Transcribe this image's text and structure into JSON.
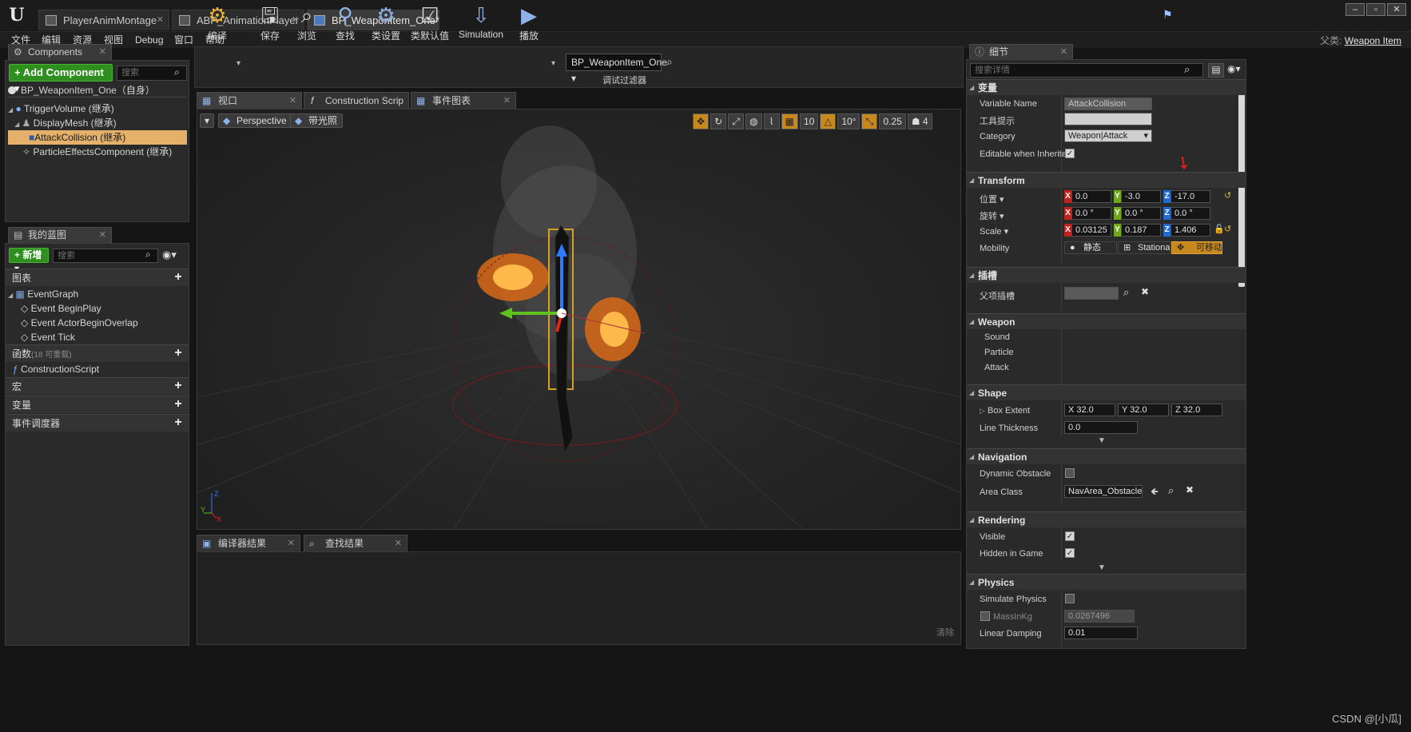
{
  "doc_tabs": [
    {
      "label": "PlayerAnimMontage",
      "active": false
    },
    {
      "label": "ABP_AnimationPlayer",
      "active": false
    },
    {
      "label": "BP_WeaponItem_One*",
      "active": true
    }
  ],
  "window_buttons": [
    "–",
    "▫",
    "✕"
  ],
  "menu": [
    "文件",
    "编辑",
    "资源",
    "视图",
    "Debug",
    "窗口",
    "帮助"
  ],
  "parent_class": {
    "prefix": "父类:",
    "name": "Weapon Item"
  },
  "components": {
    "tab": "Components",
    "add_button": "+ Add Component ▾",
    "search_placeholder": "搜索",
    "self_item": "BP_WeaponItem_One（自身）",
    "tree": [
      {
        "label": "TriggerVolume (继承)",
        "selected": false
      },
      {
        "label": "DisplayMesh (继承)",
        "selected": false
      },
      {
        "label": "AttackCollision (继承)",
        "selected": true
      },
      {
        "label": "ParticleEffectsComponent (继承)",
        "selected": false
      }
    ]
  },
  "my_blueprint": {
    "tab": "我的蓝图",
    "new_button": "+ 新增 ▾",
    "search_placeholder": "搜索",
    "graph_section": "图表",
    "event_graph": "EventGraph",
    "events": [
      "Event BeginPlay",
      "Event ActorBeginOverlap",
      "Event Tick"
    ],
    "functions_section": "函数",
    "functions_count": "(18 可重载)",
    "construction_script": "ConstructionScript",
    "macros_section": "宏",
    "variables_section": "变量",
    "dispatchers_section": "事件调度器"
  },
  "toolbar": {
    "compile": "编译",
    "save": "保存",
    "browse": "浏览",
    "find": "查找",
    "class_settings": "类设置",
    "class_defaults": "类默认值",
    "simulation": "Simulation",
    "play": "播放",
    "debug_object": "BP_WeaponItem_One ▾",
    "debug_filter": "调试过滤器"
  },
  "editor_tabs": [
    {
      "label": "视口",
      "active": true
    },
    {
      "label": "Construction Scrip",
      "active": false
    },
    {
      "label": "事件图表",
      "active": false
    }
  ],
  "viewport": {
    "perspective": "Perspective",
    "lit": "带光照",
    "grid_snap": "10",
    "rot_snap": "10°",
    "scale_snap": "0.25",
    "cam_speed": "4",
    "axis_y": "Y",
    "axis_z": "Z",
    "axis_x": "X"
  },
  "output_tabs": [
    "编译器结果",
    "查找结果"
  ],
  "output_clear": "清除",
  "details": {
    "tab": "细节",
    "search_placeholder": "搜索详情",
    "variable_section": "变量",
    "variable_name_label": "Variable Name",
    "variable_name": "AttackCollision",
    "tooltip_label": "工具提示",
    "tooltip_value": "",
    "category_label": "Category",
    "category_value": "Weapon|Attack",
    "editable_label": "Editable when Inherited",
    "transform_section": "Transform",
    "location_label": "位置 ▾",
    "location": {
      "x": "0.0",
      "y": "-3.0",
      "z": "-17.0"
    },
    "rotation_label": "旋转 ▾",
    "rotation": {
      "x": "0.0 °",
      "y": "0.0 °",
      "z": "0.0 °"
    },
    "scale_label": "Scale ▾",
    "scale": {
      "x": "0.03125",
      "y": "0.187",
      "z": "1.406"
    },
    "mobility_label": "Mobility",
    "mobility_static": "静态",
    "mobility_stationary": "Stationa",
    "mobility_movable": "可移动",
    "sockets_section": "插槽",
    "parent_socket_label": "父项插槽",
    "weapon_section": "Weapon",
    "weapon_items": [
      "Sound",
      "Particle",
      "Attack"
    ],
    "shape_section": "Shape",
    "box_extent_label": "Box Extent",
    "box_extent": {
      "x": "X  32.0",
      "y": "Y  32.0",
      "z": "Z  32.0"
    },
    "line_thickness_label": "Line Thickness",
    "line_thickness": "0.0",
    "navigation_section": "Navigation",
    "dynamic_obstacle_label": "Dynamic Obstacle",
    "area_class_label": "Area Class",
    "area_class_value": "NavArea_Obstacle ▾",
    "rendering_section": "Rendering",
    "visible_label": "Visible",
    "hidden_label": "Hidden in Game",
    "physics_section": "Physics",
    "simulate_physics_label": "Simulate Physics",
    "mass_label": "MassInKg",
    "mass_value": "0.0267496",
    "linear_damping_label": "Linear Damping",
    "linear_damping": "0.01"
  },
  "watermark": "CSDN @[小瓜]",
  "colors": {
    "accent_orange": "#e4b06a",
    "green_button": "#2e8f1f",
    "movable": "#c7881e"
  }
}
